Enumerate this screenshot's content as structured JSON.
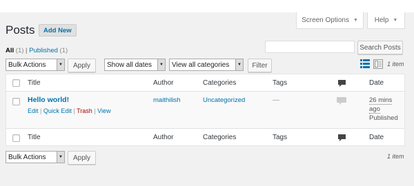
{
  "header": {
    "screen_options_label": "Screen Options",
    "help_label": "Help",
    "page_title": "Posts",
    "add_new_label": "Add New"
  },
  "filters": {
    "all_label": "All",
    "all_count": "(1)",
    "separator": "|",
    "published_label": "Published",
    "published_count": "(1)"
  },
  "search": {
    "value": "",
    "button_label": "Search Posts"
  },
  "toolbar_top": {
    "bulk_actions": "Bulk Actions",
    "apply_label": "Apply",
    "dates_select": "Show all dates",
    "categories_select": "View all categories",
    "filter_label": "Filter",
    "items_count": "1 item"
  },
  "table": {
    "columns": {
      "title": "Title",
      "author": "Author",
      "categories": "Categories",
      "tags": "Tags",
      "date": "Date"
    },
    "rows": [
      {
        "title": "Hello world!",
        "actions": {
          "edit": "Edit",
          "quick_edit": "Quick Edit",
          "trash": "Trash",
          "view": "View",
          "sep": "|"
        },
        "author": "maithilish",
        "categories": "Uncategorized",
        "tags": "—",
        "comments": "",
        "date_line1": "26 mins",
        "date_line2": "ago",
        "status": "Published"
      }
    ]
  },
  "toolbar_bottom": {
    "bulk_actions": "Bulk Actions",
    "apply_label": "Apply",
    "items_count": "1 item"
  },
  "icons": {
    "list_view": "list-view-icon",
    "excerpt_view": "excerpt-view-icon",
    "comment": "comment-bubble-icon"
  },
  "colors": {
    "link": "#0073aa",
    "trash": "#aa0000",
    "active_view": "#0073aa"
  }
}
